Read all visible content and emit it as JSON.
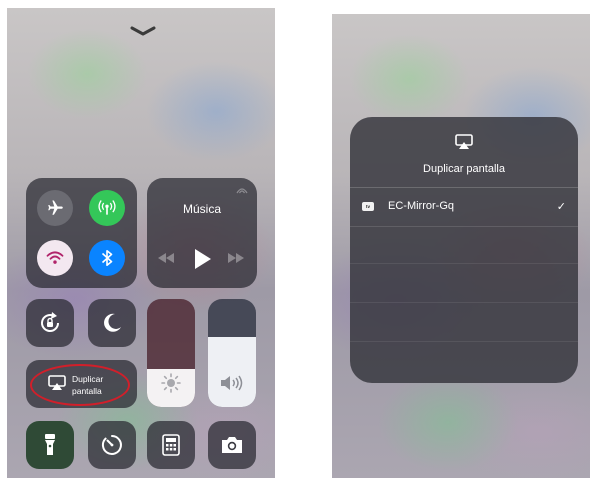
{
  "control_center": {
    "music_title": "Música",
    "screen_mirroring_label": "Duplicar pantalla",
    "screen_mirroring_line1": "Duplicar",
    "screen_mirroring_line2": "pantalla",
    "brightness_level": 0.35,
    "volume_level": 0.65,
    "airplane_icon": "airplane-icon",
    "colors": {
      "tile_bg": "#28282f",
      "airplane_bg": "#6b6b72",
      "cellular_green": "#34c759",
      "wifi_bg": "#f3e8f0",
      "bluetooth_blue": "#0a84ff",
      "annotation_red": "#d11f2a"
    }
  },
  "mirroring_panel": {
    "title": "Duplicar pantalla",
    "device_badge": "tv",
    "device_name": "EC-Mirror-Gq",
    "selected_mark": "✓"
  }
}
